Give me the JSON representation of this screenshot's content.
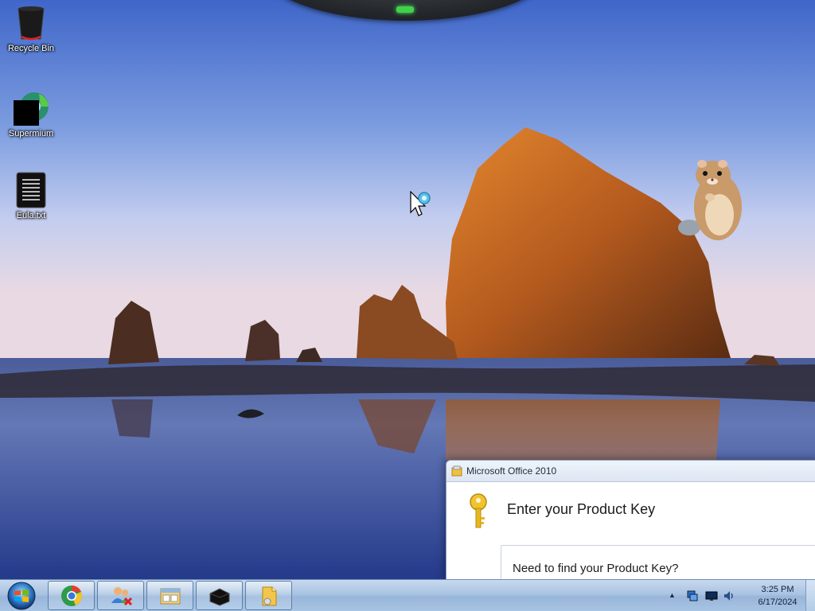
{
  "desktop": {
    "icons": [
      {
        "label": "Recycle Bin",
        "icon": "recycle-bin-icon"
      },
      {
        "label": "Supermium",
        "icon": "supermium-browser-icon"
      },
      {
        "label": "Eula.txt",
        "icon": "text-file-icon"
      }
    ]
  },
  "dialog": {
    "title": "Microsoft Office 2010",
    "heading": "Enter your Product Key",
    "find_key_text": "Need to find your Product Key?"
  },
  "taskbar": {
    "buttons": [
      {
        "icon": "chrome-browser-icon"
      },
      {
        "icon": "network-users-icon"
      },
      {
        "icon": "file-explorer-window-icon"
      },
      {
        "icon": "black-box-app-icon"
      },
      {
        "icon": "office-setup-icon"
      }
    ],
    "tray": {
      "time": "3:25 PM",
      "date": "6/17/2024",
      "icons": [
        "network-icon",
        "display-icon",
        "volume-icon"
      ]
    }
  },
  "colors": {
    "taskbar": "#a9c3e2",
    "dialog_border": "#8aa1c0",
    "gadget_led": "#3fd24a"
  }
}
